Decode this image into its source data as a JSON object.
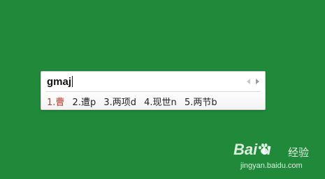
{
  "colors": {
    "background": "#21893a",
    "panel": "#ffffff",
    "selected_candidate": "#c0392b",
    "candidate_text": "#222222"
  },
  "ime": {
    "composition": "gmaj",
    "page_prev_icon": "chevron-left-icon",
    "page_next_icon": "chevron-right-icon",
    "candidates": [
      {
        "label": "1.曹",
        "selected": true
      },
      {
        "label": "2.遭p",
        "selected": false
      },
      {
        "label": "3.两项d",
        "selected": false
      },
      {
        "label": "4.现世n",
        "selected": false
      },
      {
        "label": "5.两节b",
        "selected": false
      }
    ]
  },
  "watermark": {
    "logo": "Bai  u",
    "logo_cn": "经验",
    "url": "jingyan.baidu.com"
  }
}
